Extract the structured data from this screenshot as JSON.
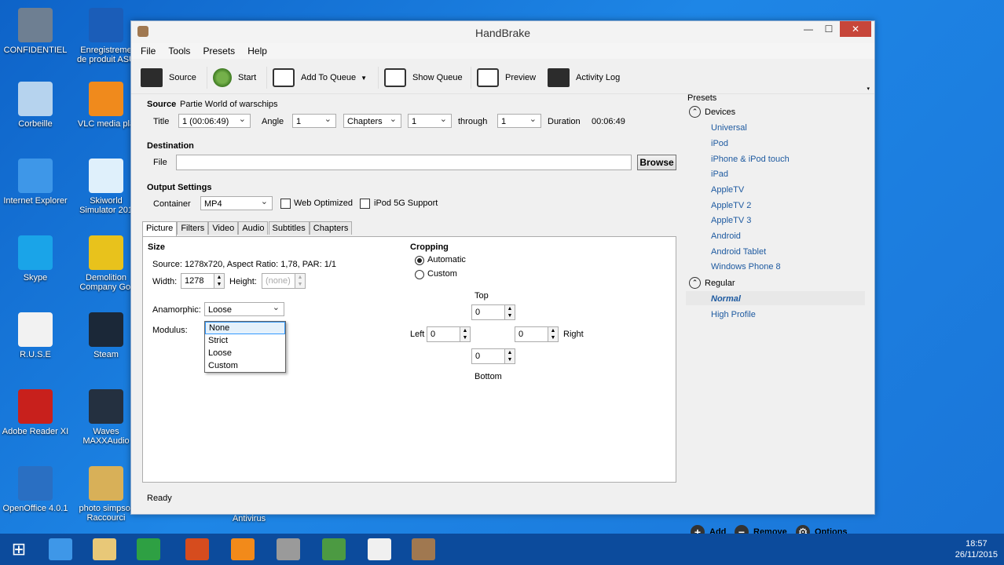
{
  "desktop": {
    "icons": [
      {
        "label1": "CONFIDENTIEL",
        "label2": "",
        "color": "#6e7f92"
      },
      {
        "label1": "Enregistreme",
        "label2": "de produit ASU",
        "color": "#1b5db8"
      },
      {
        "label1": "Corbeille",
        "label2": "",
        "color": "#b6d3ee"
      },
      {
        "label1": "VLC media pla",
        "label2": "",
        "color": "#f08a1c"
      },
      {
        "label1": "Internet Explorer",
        "label2": "",
        "color": "#3e97e8"
      },
      {
        "label1": "Skiworld",
        "label2": "Simulator 201",
        "color": "#dff0fb"
      },
      {
        "label1": "Skype",
        "label2": "",
        "color": "#1aa4e8"
      },
      {
        "label1": "Demolition",
        "label2": "Company Gol",
        "color": "#e8c21c"
      },
      {
        "label1": "R.U.S.E",
        "label2": "",
        "color": "#f2f2f2"
      },
      {
        "label1": "Steam",
        "label2": "",
        "color": "#1b2838"
      },
      {
        "label1": "Adobe Reader XI",
        "label2": "",
        "color": "#c8201c"
      },
      {
        "label1": "Waves",
        "label2": "MAXXAudio",
        "color": "#243040"
      },
      {
        "label1": "OpenOffice 4.0.1",
        "label2": "",
        "color": "#2a6fc2"
      },
      {
        "label1": "photo simpsor",
        "label2": "Raccourci",
        "color": "#d8b058"
      }
    ],
    "antivirus_label": "Antivirus"
  },
  "window": {
    "title": "HandBrake",
    "controls": {
      "min": "—",
      "max": "☐",
      "close": "✕"
    }
  },
  "menu": [
    "File",
    "Tools",
    "Presets",
    "Help"
  ],
  "toolbar": {
    "source": "Source",
    "start": "Start",
    "add_to_queue": "Add To Queue",
    "show_queue": "Show Queue",
    "preview": "Preview",
    "activity_log": "Activity Log"
  },
  "source": {
    "label": "Source",
    "name": "Partie World of warschips",
    "title_label": "Title",
    "title_value": "1 (00:06:49)",
    "angle_label": "Angle",
    "angle_value": "1",
    "chapters_value": "Chapters",
    "chapter_start": "1",
    "through_label": "through",
    "chapter_end": "1",
    "duration_label": "Duration",
    "duration_value": "00:06:49"
  },
  "destination": {
    "label": "Destination",
    "file_label": "File",
    "file_value": "",
    "browse": "Browse"
  },
  "output": {
    "label": "Output Settings",
    "container_label": "Container",
    "container_value": "MP4",
    "web_optimized": "Web Optimized",
    "ipod_support": "iPod 5G Support"
  },
  "tabs": [
    "Picture",
    "Filters",
    "Video",
    "Audio",
    "Subtitles",
    "Chapters"
  ],
  "picture": {
    "size_label": "Size",
    "source_info": "Source:  1278x720, Aspect Ratio: 1,78, PAR: 1/1",
    "width_label": "Width:",
    "width_value": "1278",
    "height_label": "Height:",
    "height_value": "(none)",
    "anamorphic_label": "Anamorphic:",
    "anamorphic_value": "Loose",
    "modulus_label": "Modulus:",
    "anamorphic_options": [
      "None",
      "Strict",
      "Loose",
      "Custom"
    ]
  },
  "cropping": {
    "label": "Cropping",
    "automatic": "Automatic",
    "custom": "Custom",
    "top_label": "Top",
    "bottom_label": "Bottom",
    "left_label": "Left",
    "right_label": "Right",
    "top": "0",
    "bottom": "0",
    "left": "0",
    "right": "0"
  },
  "status": "Ready",
  "presets": {
    "header": "Presets",
    "devices_label": "Devices",
    "devices": [
      "Universal",
      "iPod",
      "iPhone & iPod touch",
      "iPad",
      "AppleTV",
      "AppleTV 2",
      "AppleTV 3",
      "Android",
      "Android Tablet",
      "Windows Phone 8"
    ],
    "regular_label": "Regular",
    "regular": [
      "Normal",
      "High Profile"
    ],
    "add": "Add",
    "remove": "Remove",
    "options": "Options"
  },
  "taskbar": {
    "time": "18:57",
    "date": "26/11/2015"
  }
}
